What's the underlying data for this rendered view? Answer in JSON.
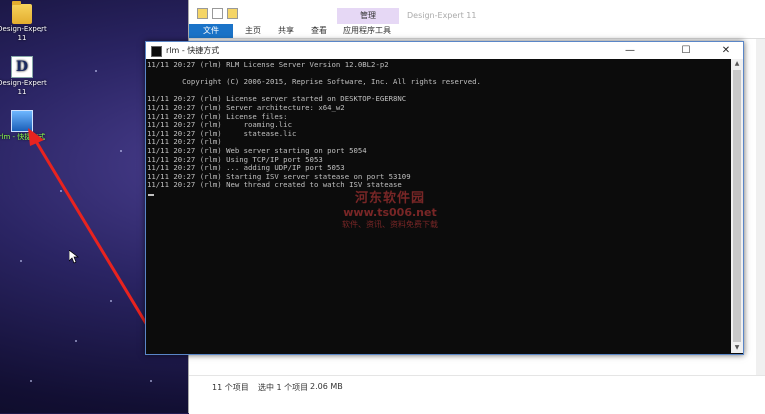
{
  "desktop": {
    "icons": [
      {
        "label": "Design-Expert 11",
        "icon": "folder-icon"
      },
      {
        "label": "Design-Expert 11",
        "icon": "design-expert-icon"
      },
      {
        "label": "rlm - 快捷方式",
        "icon": "rlm-shortcut-icon"
      }
    ]
  },
  "explorer": {
    "app_title": "Design-Expert 11",
    "context_tab": "管理",
    "ribbon_tabs": [
      "文件",
      "主页",
      "共享",
      "查看",
      "应用程序工具"
    ],
    "status": {
      "item_count": "11 个项目",
      "selected": "选中 1 个项目",
      "size": "2.06 MB"
    }
  },
  "console": {
    "title": "rlm - 快捷方式",
    "buttons": {
      "minimize": "—",
      "maximize": "☐",
      "close": "✕"
    },
    "lines": [
      "11/11 20:27 (rlm) RLM License Server Version 12.0BL2-p2",
      "",
      "        Copyright (C) 2006-2015, Reprise Software, Inc. All rights reserved.",
      "",
      "11/11 20:27 (rlm) License server started on DESKTOP-EGER8NC",
      "11/11 20:27 (rlm) Server architecture: x64_w2",
      "11/11 20:27 (rlm) License files:",
      "11/11 20:27 (rlm)     roaming.lic",
      "11/11 20:27 (rlm)     statease.lic",
      "11/11 20:27 (rlm)",
      "11/11 20:27 (rlm) Web server starting on port 5054",
      "11/11 20:27 (rlm) Using TCP/IP port 5053",
      "11/11 20:27 (rlm) ... adding UDP/IP port 5053",
      "11/11 20:27 (rlm) Starting ISV server statease on port 53109",
      "11/11 20:27 (rlm) New thread created to watch ISV statease"
    ]
  },
  "watermark": {
    "line1": "河东软件园",
    "line2": "www.ts006.net",
    "line3": "软件、资讯、资料免费下载"
  }
}
